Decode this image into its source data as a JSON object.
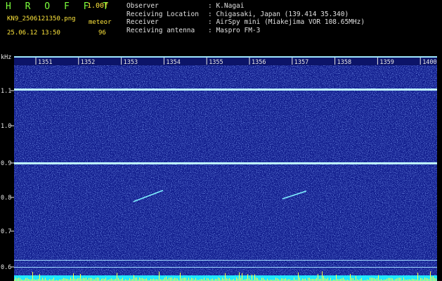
{
  "header": {
    "app_name": "H R O F F T",
    "version": "1.00f",
    "file_name": "KN9_2506121350.png",
    "timestamp": "25.06.12 13:50",
    "meteor_label": "meteor",
    "meteor_count": "96"
  },
  "info": [
    {
      "key": "Observer",
      "value": ": K.Nagai"
    },
    {
      "key": "Receiving Location",
      "value": ": Chigasaki, Japan (139.414 35.340)"
    },
    {
      "key": "Receiver",
      "value": ": AirSpy mini (Miakejima VOR 108.65MHz)"
    },
    {
      "key": "Receiving antenna",
      "value": ": Maspro FM-3"
    }
  ],
  "y_axis": {
    "unit": "kHz",
    "ticks": [
      "1.1",
      "1.0",
      "0.9",
      "0.8",
      "0.7",
      "0.6"
    ]
  },
  "time_labels": [
    "1351",
    "1352",
    "1353",
    "1354",
    "1355",
    "1356",
    "1357",
    "1358",
    "1359",
    "1400"
  ],
  "colors": {
    "background_dark": "#101c8c",
    "noise_light": "#4a6cff",
    "carrier_line": "#bff8ff",
    "header_green": "#7cff3c",
    "header_yellow": "#ffe63c",
    "bottom_cyan": "#20e8ff",
    "bottom_yellow": "#ffff40"
  }
}
